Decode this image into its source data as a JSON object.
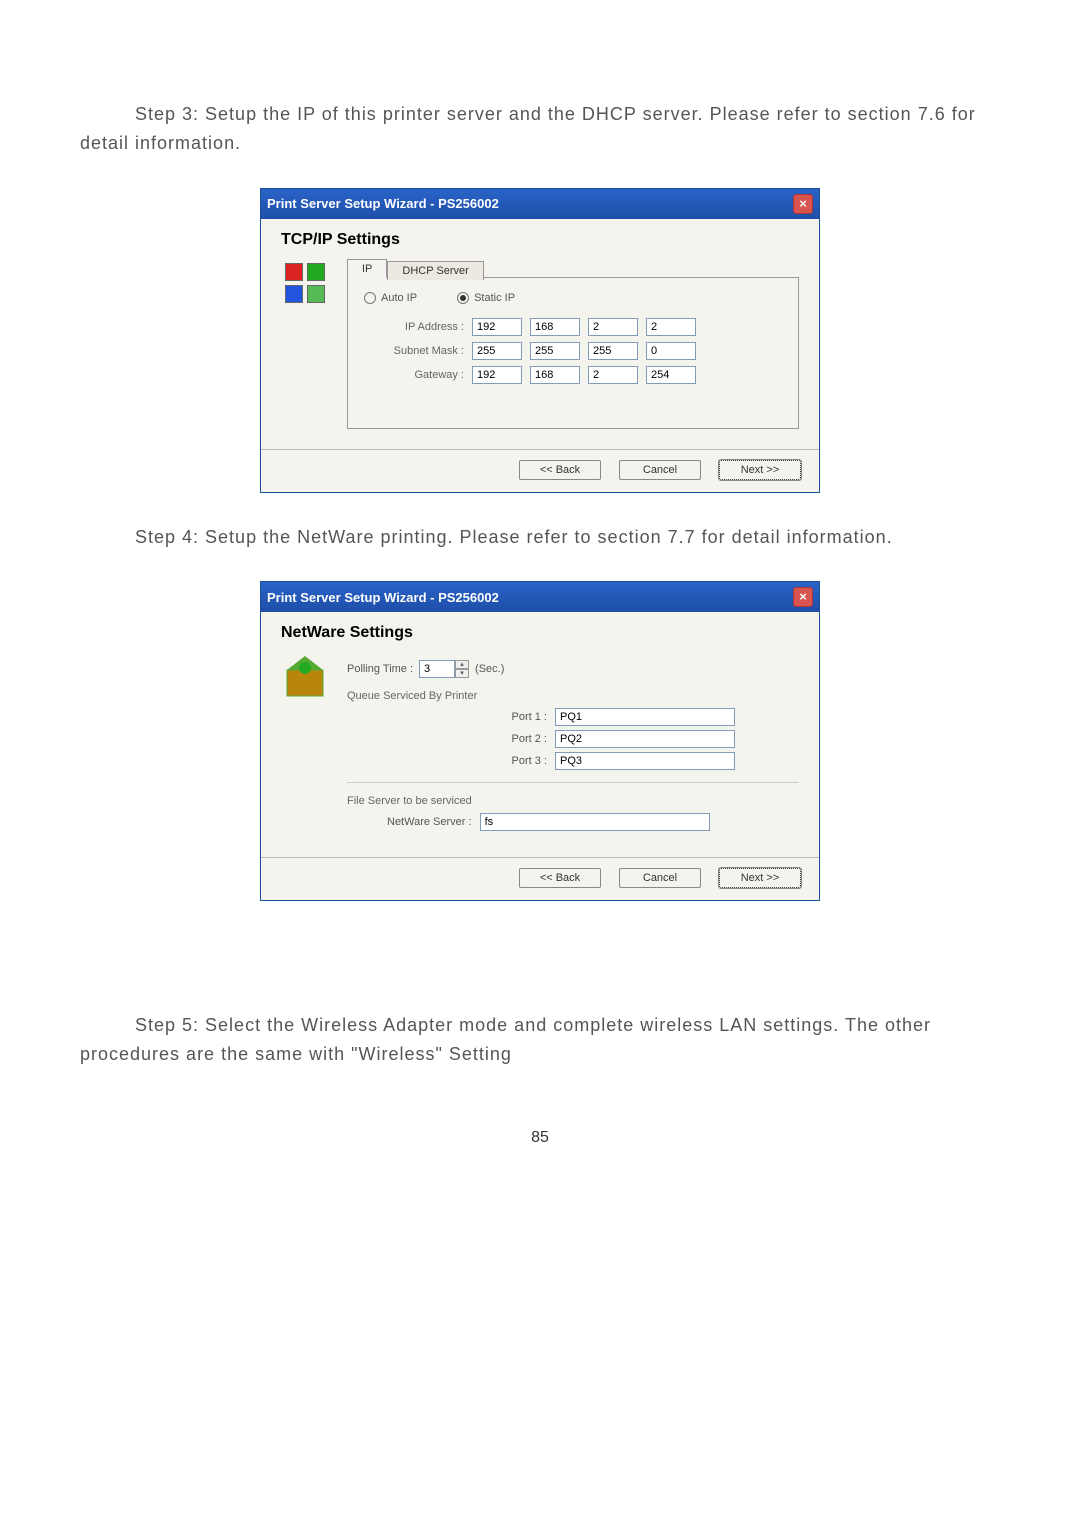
{
  "para1": "Step 3: Setup the IP of this printer server and the DHCP server. Please refer to section 7.6 for detail information.",
  "para2": "Step 4: Setup the NetWare printing. Please refer to section 7.7 for detail information.",
  "para3": "Step 5: Select the Wireless Adapter mode and complete wireless LAN settings. The other procedures are the same with \"Wireless\" Setting",
  "pageNum": "85",
  "dialog1": {
    "title": "Print Server Setup Wizard - PS256002",
    "sectionHead": "TCP/IP Settings",
    "tabs": {
      "ip": "IP",
      "dhcp": "DHCP Server"
    },
    "radio": {
      "auto": "Auto IP",
      "static": "Static IP"
    },
    "labels": {
      "ipaddr": "IP Address :",
      "subnet": "Subnet Mask :",
      "gateway": "Gateway :"
    },
    "ip": {
      "a": "192",
      "b": "168",
      "c": "2",
      "d": "2"
    },
    "mask": {
      "a": "255",
      "b": "255",
      "c": "255",
      "d": "0"
    },
    "gw": {
      "a": "192",
      "b": "168",
      "c": "2",
      "d": "254"
    },
    "back": "<< Back",
    "cancel": "Cancel",
    "next": "Next >>"
  },
  "dialog2": {
    "title": "Print Server Setup Wizard - PS256002",
    "sectionHead": "NetWare Settings",
    "pollLabel": "Polling Time :",
    "pollValue": "3",
    "pollUnit": "(Sec.)",
    "queueLabel": "Queue Serviced By Printer",
    "ports": {
      "p1l": "Port 1 :",
      "p1v": "PQ1",
      "p2l": "Port 2 :",
      "p2v": "PQ2",
      "p3l": "Port 3 :",
      "p3v": "PQ3"
    },
    "fileServerLabel": "File Server to be serviced",
    "nwServerLabel": "NetWare Server :",
    "nwServerValue": "fs",
    "back": "<< Back",
    "cancel": "Cancel",
    "next": "Next >>"
  }
}
